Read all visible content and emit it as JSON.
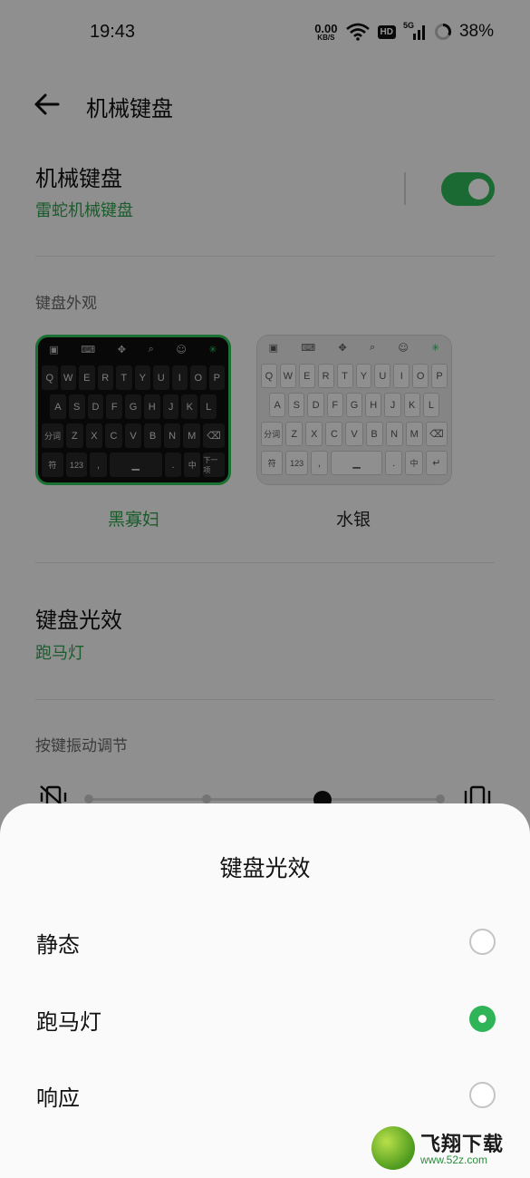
{
  "status_bar": {
    "time": "19:43",
    "net_speed_value": "0.00",
    "net_speed_unit": "KB/S",
    "hd_badge": "HD",
    "signal_label": "5G",
    "battery": "38%"
  },
  "header": {
    "title": "机械键盘"
  },
  "mech_keyboard": {
    "title": "机械键盘",
    "subtitle": "雷蛇机械键盘",
    "enabled": true
  },
  "appearance": {
    "label": "键盘外观",
    "themes": [
      {
        "name": "黑寡妇",
        "selected": true
      },
      {
        "name": "水银",
        "selected": false
      }
    ],
    "keyboard_keys": {
      "row1": [
        "Q",
        "W",
        "E",
        "R",
        "T",
        "Y",
        "U",
        "I",
        "O",
        "P"
      ],
      "row2": [
        "A",
        "S",
        "D",
        "F",
        "G",
        "H",
        "J",
        "K",
        "L"
      ],
      "row3": [
        "分词",
        "Z",
        "X",
        "C",
        "V",
        "B",
        "N",
        "M",
        "⌫"
      ],
      "row4_left": [
        "符",
        "123",
        ","
      ],
      "row4_right": [
        ".",
        "中"
      ],
      "dark_enter": "下一项",
      "light_enter": "↵"
    }
  },
  "lighting": {
    "title": "键盘光效",
    "subtitle": "跑马灯"
  },
  "vibration": {
    "label": "按键振动调节",
    "level": 3,
    "levels": 4
  },
  "sheet": {
    "title": "键盘光效",
    "options": [
      {
        "label": "静态",
        "selected": false
      },
      {
        "label": "跑马灯",
        "selected": true
      },
      {
        "label": "响应",
        "selected": false
      }
    ]
  },
  "watermark": {
    "title": "飞翔下载",
    "url": "www.52z.com"
  },
  "colors": {
    "accent": "#2fb558",
    "dark_theme_border": "#2fc35a"
  }
}
